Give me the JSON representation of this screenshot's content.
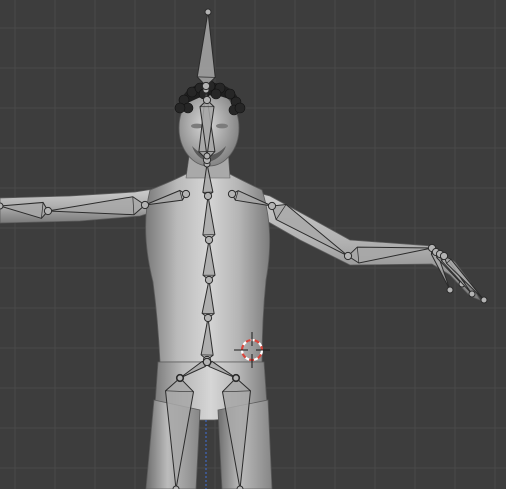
{
  "app": {
    "name": "",
    "view": "3D Viewport"
  },
  "scene": {
    "grid": true,
    "object_shading": "solid",
    "armature_display": "octahedral",
    "cursor_icon": "3d-cursor-icon",
    "mesh": "humanoid-body",
    "colors": {
      "background": "#3d3d3d",
      "grid_line": "#494949",
      "mesh_light": "#c9c9c9",
      "mesh_dark": "#6a6a6a",
      "bone_fill": "#a8a8a8",
      "bone_stroke": "#2b2b2b",
      "cursor_red": "#d9463c",
      "cursor_white": "#ffffff",
      "axis_blue": "#3f6fd6"
    }
  }
}
